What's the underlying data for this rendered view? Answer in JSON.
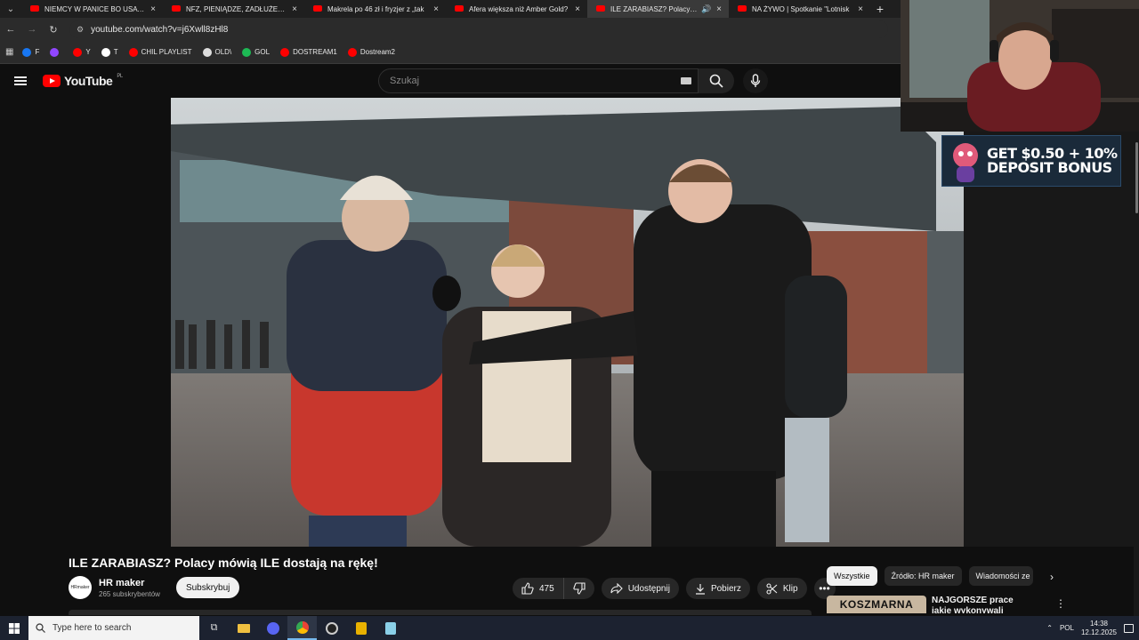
{
  "browser": {
    "tabs": [
      {
        "title": "NIEMCY W PANICE BO USA STA",
        "active": false
      },
      {
        "title": "NFZ, PIENIĄDZE, ZADŁUŻENIE",
        "active": false
      },
      {
        "title": "Makrela po 46 zł i fryzjer z „tak",
        "active": false
      },
      {
        "title": "Afera większa niż Amber Gold?",
        "active": false
      },
      {
        "title": "ILE ZARABIASZ? Polacy mó",
        "active": true
      },
      {
        "title": "NA ŻYWO | Spotkanie \"Lotnisk",
        "active": false
      }
    ],
    "url": "youtube.com/watch?v=j6Xwll8zHl8",
    "bookmarks": [
      {
        "label": "F",
        "color": "#1877f2"
      },
      {
        "label": "",
        "color": "#9146ff"
      },
      {
        "label": "Y",
        "color": "#ff0000"
      },
      {
        "label": "T",
        "color": "#ffffff"
      },
      {
        "label": "CHIL PLAYLIST",
        "color": "#ff0000"
      },
      {
        "label": "OLD\\",
        "color": "#dddddd"
      },
      {
        "label": "GOL",
        "color": "#1db954"
      },
      {
        "label": "DOSTREAM1",
        "color": "#ff0000"
      },
      {
        "label": "Dostream2",
        "color": "#ff0000"
      }
    ]
  },
  "youtube": {
    "logo": "YouTube",
    "region": "PL",
    "search_placeholder": "Szukaj"
  },
  "overlay": {
    "bonus_line1": "GET $0.50 + 10%",
    "bonus_line2": "DEPOSIT BONUS"
  },
  "video": {
    "title": "ILE ZARABIASZ? Polacy mówią ILE dostają na rękę!",
    "channel": "HR maker",
    "avatar_text": "HRmaker",
    "subscribers": "265 subskrybentów",
    "subscribe_label": "Subskrybuj",
    "likes": "475",
    "share_label": "Udostępnij",
    "download_label": "Pobierz",
    "clip_label": "Klip"
  },
  "chips": [
    {
      "label": "Wszystkie",
      "active": true
    },
    {
      "label": "Źródło: HR maker",
      "active": false
    },
    {
      "label": "Wiadomości ze",
      "active": false
    }
  ],
  "recommendation": {
    "thumb_text": "KOSZMARNA",
    "title": "NAJGORSZE prace jakie wykonywali Polacy?"
  },
  "taskbar": {
    "search_placeholder": "Type here to search",
    "language": "POL",
    "time": "14:38",
    "date": "12.12.2025"
  }
}
